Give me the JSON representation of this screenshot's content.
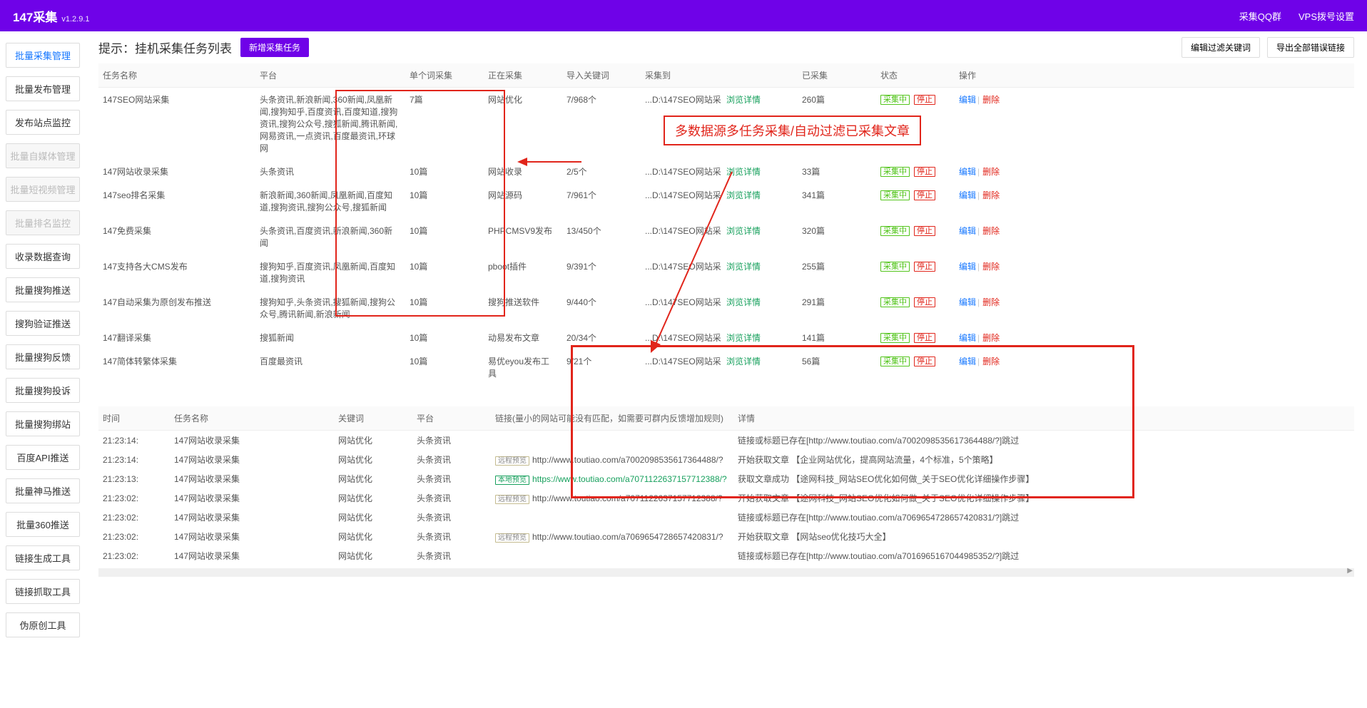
{
  "header": {
    "title": "147采集",
    "version": "v1.2.9.1",
    "qq_group": "采集QQ群",
    "vps_dial": "VPS拨号设置"
  },
  "sidebar": [
    {
      "label": "批量采集管理",
      "state": "active"
    },
    {
      "label": "批量发布管理",
      "state": ""
    },
    {
      "label": "发布站点监控",
      "state": ""
    },
    {
      "label": "批量自媒体管理",
      "state": "disabled"
    },
    {
      "label": "批量短视频管理",
      "state": "disabled"
    },
    {
      "label": "批量排名监控",
      "state": "disabled"
    },
    {
      "label": "收录数据查询",
      "state": ""
    },
    {
      "label": "批量搜狗推送",
      "state": ""
    },
    {
      "label": "搜狗验证推送",
      "state": ""
    },
    {
      "label": "批量搜狗反馈",
      "state": ""
    },
    {
      "label": "批量搜狗投诉",
      "state": ""
    },
    {
      "label": "批量搜狗绑站",
      "state": ""
    },
    {
      "label": "百度API推送",
      "state": ""
    },
    {
      "label": "批量神马推送",
      "state": ""
    },
    {
      "label": "批量360推送",
      "state": ""
    },
    {
      "label": "链接生成工具",
      "state": ""
    },
    {
      "label": "链接抓取工具",
      "state": ""
    },
    {
      "label": "伪原创工具",
      "state": ""
    }
  ],
  "page": {
    "hint": "提示：挂机采集任务列表",
    "new_task": "新增采集任务",
    "edit_filter": "编辑过滤关键词",
    "export_errors": "导出全部错误链接",
    "annot": "多数据源多任务采集/自动过滤已采集文章"
  },
  "task_columns": {
    "name": "任务名称",
    "platform": "平台",
    "single": "单个词采集",
    "collecting": "正在采集",
    "import_kw": "导入关键词",
    "collect_to": "采集到",
    "collected": "已采集",
    "status": "状态",
    "ops": "操作"
  },
  "tasks": [
    {
      "name": "147SEO网站采集",
      "platform": "头条资讯,新浪新闻,360新闻,凤凰新闻,搜狗知乎,百度资讯,百度知道,搜狗资讯,搜狗公众号,搜狐新闻,腾讯新闻,网易资讯,一点资讯,百度最资讯,环球网",
      "single": "7篇",
      "collecting": "网站优化",
      "import_kw": "7/968个",
      "collect_to": "...D:\\147SEO网站采",
      "detail": "浏览详情",
      "collected": "260篇",
      "status": "采集中",
      "stop": "停止"
    },
    {
      "name": "147网站收录采集",
      "platform": "头条资讯",
      "single": "10篇",
      "collecting": "网站收录",
      "import_kw": "2/5个",
      "collect_to": "...D:\\147SEO网站采",
      "detail": "浏览详情",
      "collected": "33篇",
      "status": "采集中",
      "stop": "停止"
    },
    {
      "name": "147seo排名采集",
      "platform": "新浪新闻,360新闻,凤凰新闻,百度知道,搜狗资讯,搜狗公众号,搜狐新闻",
      "single": "10篇",
      "collecting": "网站源码",
      "import_kw": "7/961个",
      "collect_to": "...D:\\147SEO网站采",
      "detail": "浏览详情",
      "collected": "341篇",
      "status": "采集中",
      "stop": "停止"
    },
    {
      "name": "147免费采集",
      "platform": "头条资讯,百度资讯,新浪新闻,360新闻",
      "single": "10篇",
      "collecting": "PHPCMSV9发布",
      "import_kw": "13/450个",
      "collect_to": "...D:\\147SEO网站采",
      "detail": "浏览详情",
      "collected": "320篇",
      "status": "采集中",
      "stop": "停止"
    },
    {
      "name": "147支持各大CMS发布",
      "platform": "搜狗知乎,百度资讯,凤凰新闻,百度知道,搜狗资讯",
      "single": "10篇",
      "collecting": "pboot插件",
      "import_kw": "9/391个",
      "collect_to": "...D:\\147SEO网站采",
      "detail": "浏览详情",
      "collected": "255篇",
      "status": "采集中",
      "stop": "停止"
    },
    {
      "name": "147自动采集为原创发布推送",
      "platform": "搜狗知乎,头条资讯,搜狐新闻,搜狗公众号,腾讯新闻,新浪新闻",
      "single": "10篇",
      "collecting": "搜狗推送软件",
      "import_kw": "9/440个",
      "collect_to": "...D:\\147SEO网站采",
      "detail": "浏览详情",
      "collected": "291篇",
      "status": "采集中",
      "stop": "停止"
    },
    {
      "name": "147翻译采集",
      "platform": "搜狐新闻",
      "single": "10篇",
      "collecting": "动易发布文章",
      "import_kw": "20/34个",
      "collect_to": "...D:\\147SEO网站采",
      "detail": "浏览详情",
      "collected": "141篇",
      "status": "采集中",
      "stop": "停止"
    },
    {
      "name": "147简体转繁体采集",
      "platform": "百度最资讯",
      "single": "10篇",
      "collecting": "易优eyou发布工具",
      "import_kw": "9/21个",
      "collect_to": "...D:\\147SEO网站采",
      "detail": "浏览详情",
      "collected": "56篇",
      "status": "采集中",
      "stop": "停止"
    }
  ],
  "ops": {
    "edit": "编辑",
    "del": "删除"
  },
  "log_columns": {
    "time": "时间",
    "task": "任务名称",
    "keyword": "关键词",
    "platform": "平台",
    "link": "链接(量小的网站可能没有匹配，如需要可群内反馈增加规则)",
    "detail": "详情"
  },
  "tags": {
    "remote": "远程预览",
    "local": "本地预览"
  },
  "logs": [
    {
      "time": "21:23:14:",
      "task": "147网站收录采集",
      "keyword": "网站优化",
      "platform": "头条资讯",
      "link_tag": "",
      "link": "",
      "detail": "链接或标题已存在[http://www.toutiao.com/a7002098535617364488/?]跳过"
    },
    {
      "time": "21:23:14:",
      "task": "147网站收录采集",
      "keyword": "网站优化",
      "platform": "头条资讯",
      "link_tag": "remote",
      "link": "http://www.toutiao.com/a7002098535617364488/?",
      "detail": "开始获取文章 【企业网站优化，提高网站流量，4个标准，5个策略】"
    },
    {
      "time": "21:23:13:",
      "task": "147网站收录采集",
      "keyword": "网站优化",
      "platform": "头条资讯",
      "link_tag": "local",
      "link": "https://www.toutiao.com/a7071122637157712388/?",
      "link_class": "url-green",
      "detail": "获取文章成功 【途网科技_网站SEO优化如何做_关于SEO优化详细操作步骤】"
    },
    {
      "time": "21:23:02:",
      "task": "147网站收录采集",
      "keyword": "网站优化",
      "platform": "头条资讯",
      "link_tag": "remote",
      "link": "http://www.toutiao.com/a7071122637157712388/?",
      "detail": "开始获取文章 【途网科技_网站SEO优化如何做_关于SEO优化详细操作步骤】"
    },
    {
      "time": "21:23:02:",
      "task": "147网站收录采集",
      "keyword": "网站优化",
      "platform": "头条资讯",
      "link_tag": "",
      "link": "",
      "detail": "链接或标题已存在[http://www.toutiao.com/a7069654728657420831/?]跳过"
    },
    {
      "time": "21:23:02:",
      "task": "147网站收录采集",
      "keyword": "网站优化",
      "platform": "头条资讯",
      "link_tag": "remote",
      "link": "http://www.toutiao.com/a7069654728657420831/?",
      "detail": "开始获取文章 【网站seo优化技巧大全】"
    },
    {
      "time": "21:23:02:",
      "task": "147网站收录采集",
      "keyword": "网站优化",
      "platform": "头条资讯",
      "link_tag": "",
      "link": "",
      "detail": "链接或标题已存在[http://www.toutiao.com/a7016965167044985352/?]跳过"
    }
  ]
}
